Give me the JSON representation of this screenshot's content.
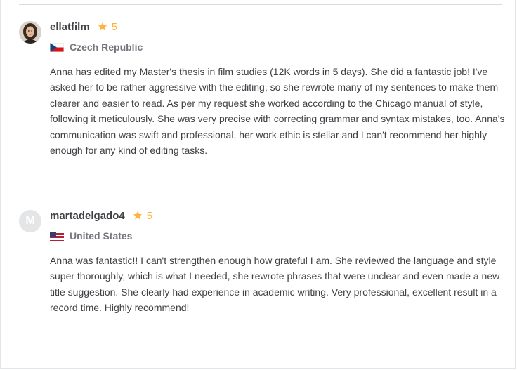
{
  "reviews": [
    {
      "username": "ellatfilm",
      "rating": "5",
      "country": "Czech Republic",
      "avatar_icon": "user-photo",
      "flag_icon": "czech-flag-icon",
      "text": "Anna has edited my Master's thesis in film studies (12K words in 5 days). She did a fantastic job! I've asked her to be rather aggressive with the editing, so she rewrote many of my sentences to make them clearer and easier to read. As per my request she worked according to the Chicago manual of style, following it meticulously. She was very precise with correcting grammar and syntax mistakes, too. Anna's communication was swift and professional, her work ethic is stellar and I can't recommend her highly enough for any kind of editing tasks."
    },
    {
      "username": "martadelgado4",
      "rating": "5",
      "country": "United States",
      "avatar_letter": "M",
      "flag_icon": "us-flag-icon",
      "text": "Anna was fantastic!! I can't strengthen enough how grateful I am. She reviewed the language and style super thoroughly, which is what I needed, she rewrote phrases that were unclear and even made a new title suggestion. She clearly had experience in academic writing. Very professional, excellent result in a record time. Highly recommend!"
    }
  ],
  "colors": {
    "star": "#ffb33e",
    "text": "#404145",
    "muted": "#74767e",
    "divider": "#dadbdd"
  }
}
